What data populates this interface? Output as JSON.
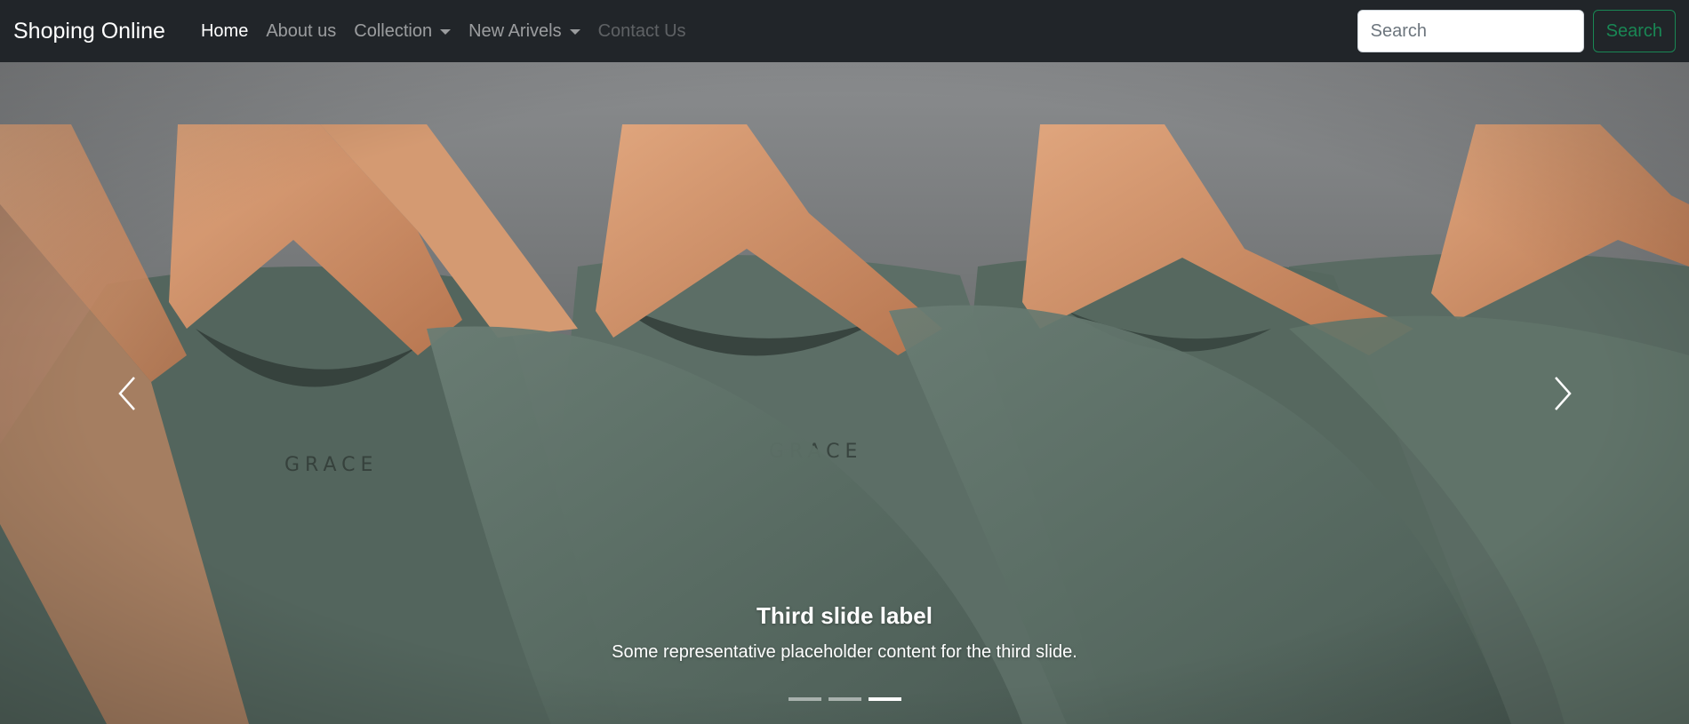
{
  "navbar": {
    "brand": "Shoping Online",
    "items": [
      {
        "label": "Home",
        "state": "active",
        "dropdown": false
      },
      {
        "label": "About us",
        "state": "normal",
        "dropdown": false
      },
      {
        "label": "Collection",
        "state": "normal",
        "dropdown": true
      },
      {
        "label": "New Arivels",
        "state": "normal",
        "dropdown": true
      },
      {
        "label": "Contact Us",
        "state": "disabled",
        "dropdown": false
      }
    ],
    "search": {
      "placeholder": "Search",
      "value": "",
      "button_label": "Search"
    }
  },
  "carousel": {
    "active_slide": 3,
    "slide_count": 3,
    "caption": {
      "title": "Third slide label",
      "text": "Some representative placeholder content for the third slide."
    },
    "controls": {
      "prev_icon": "chevron-left-icon",
      "next_icon": "chevron-right-icon"
    }
  },
  "colors": {
    "navbar_bg": "#212529",
    "search_button": "#198754",
    "shirt": "#5f7168",
    "hanger": "#c98b63",
    "backdrop": "#77797a"
  }
}
